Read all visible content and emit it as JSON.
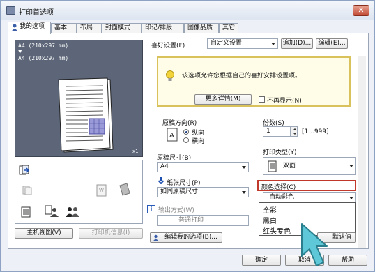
{
  "window": {
    "title": "打印首选项",
    "close_glyph": "✕"
  },
  "tabs": [
    "我的选项",
    "基本",
    "布局",
    "封面模式",
    "印记/排版",
    "图像品质",
    "其它"
  ],
  "preview": {
    "paper_line_1": "A4  (210x297 mm)",
    "arrow": "▼",
    "paper_line_2": "A4  (210x297 mm)",
    "count": "x1"
  },
  "favorite": {
    "label": "喜好设置(F)",
    "value": "自定义设置",
    "add_button": "追加(D)...",
    "edit_button": "编辑(E)..."
  },
  "tip": {
    "text": "该选项允许您根据自己的喜好安排设置项。",
    "more_button": "更多详情(M)",
    "no_show_label": "不再显示(N)"
  },
  "orientation": {
    "label": "原稿方向(R)",
    "portrait": "纵向",
    "landscape": "横向"
  },
  "copies": {
    "label": "份数(S)",
    "value": "1",
    "range": "[1...999]"
  },
  "original_size": {
    "label": "原稿尺寸(B)",
    "value": "A4"
  },
  "paper_size": {
    "label": "纸张尺寸(P)",
    "value": "如同原稿尺寸"
  },
  "output": {
    "label": "输出方式(W)",
    "value": "普通打印"
  },
  "print_type": {
    "label": "打印类型(Y)",
    "value": "双面"
  },
  "color": {
    "label": "颜色选择(C)",
    "value": "自动彩色",
    "options": [
      "全彩",
      "黑白",
      "红头专色"
    ]
  },
  "buttons": {
    "host_view": "主机视图(V)",
    "printer_info": "打印机信息(I)",
    "edit_my_tab": "编辑我的选项(B)...",
    "default": "默认值",
    "ok": "确定",
    "cancel": "取消",
    "help": "帮助"
  },
  "colors": {
    "highlight_border": "#c0392b",
    "cursor": "#5ec8d8",
    "tip_border": "#d9c15c"
  }
}
